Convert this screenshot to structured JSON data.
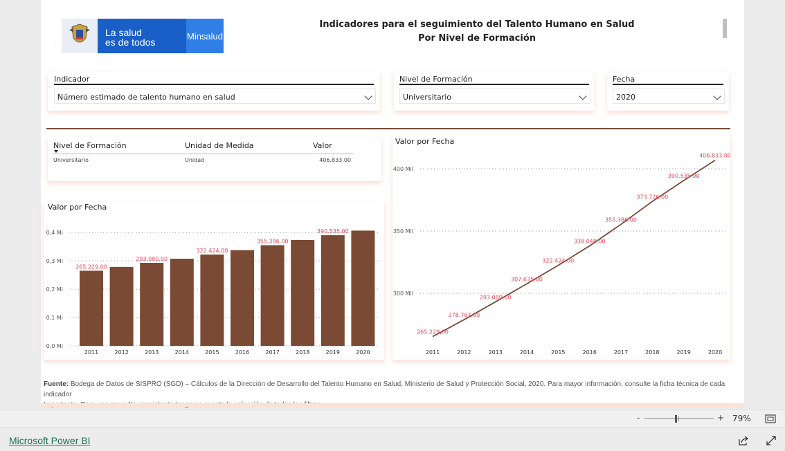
{
  "header": {
    "logo_slogan_line1": "La salud",
    "logo_slogan_line2": "es de todos",
    "logo_brand": "Minsalud",
    "title_line1": "Indicadores para el seguimiento del Talento Humano en Salud",
    "title_line2": "Por Nivel de Formación"
  },
  "filters": {
    "indicador": {
      "label": "Indicador",
      "value": "Número estimado de talento humano en salud"
    },
    "nivel": {
      "label": "Nivel de Formación",
      "value": "Universitario"
    },
    "fecha": {
      "label": "Fecha",
      "value": "2020"
    }
  },
  "table": {
    "headers": [
      "Nivel de Formación",
      "Unidad de Medida",
      "Valor"
    ],
    "row": [
      "Universitario",
      "Unidad",
      "406.833,00"
    ]
  },
  "bar_chart_title": "Valor por Fecha",
  "line_chart_title": "Valor por Fecha",
  "chart_data": [
    {
      "type": "bar",
      "title": "Valor por Fecha",
      "categories": [
        "2011",
        "2012",
        "2013",
        "2014",
        "2015",
        "2016",
        "2017",
        "2018",
        "2019",
        "2020"
      ],
      "values": [
        265229,
        278767,
        293080,
        307635,
        322424,
        338048,
        355386,
        373726,
        390535,
        406833
      ],
      "data_labels": [
        "265.229,00",
        "",
        "293.080,00",
        "",
        "322.424,00",
        "",
        "355.386,00",
        "",
        "390.535,00",
        ""
      ],
      "y_ticks": [
        0,
        100000,
        200000,
        300000,
        400000
      ],
      "y_tick_labels": [
        "0,0 Mi",
        "0,1 Mi",
        "0,2 Mi",
        "0,3 Mi",
        "0,4 Mi"
      ],
      "ylim": [
        0,
        420000
      ],
      "bar_color": "#7b4a35",
      "label_color": "#e8455a"
    },
    {
      "type": "line",
      "title": "Valor por Fecha",
      "categories": [
        "2011",
        "2012",
        "2013",
        "2014",
        "2015",
        "2016",
        "2017",
        "2018",
        "2019",
        "2020"
      ],
      "values": [
        265229,
        278767,
        293080,
        307635,
        322424,
        338048,
        355386,
        373726,
        390535,
        406833
      ],
      "data_labels": [
        "265.229,00",
        "278.767,00",
        "293.080,00",
        "307.635,00",
        "322.424,00",
        "338.048,00",
        "355.386,00",
        "373.726,00",
        "390.535,00",
        "406.833,00"
      ],
      "y_ticks": [
        300000,
        350000,
        400000
      ],
      "y_tick_labels": [
        "300 Mil",
        "350 Mil",
        "400 Mil"
      ],
      "ylim": [
        260000,
        410000
      ],
      "line_color": "#7b4a35",
      "label_color": "#e8455a"
    }
  ],
  "footer": {
    "source_label": "Fuente:",
    "source_text": " Bodega de Datos de SISPRO (SGD) – Cálculos de la Dirección de Desarrollo del Talento Humano en Salud, Ministerio de Salud y Protección Social, 2020. Para mayor información, consulte la ficha técnica de cada indicador",
    "note": "Importante: Para una consulta consistente tenga en cuenta la selección de todos los filtros."
  },
  "status": {
    "zoom_minus": "-",
    "zoom_plus": "+",
    "zoom_level": "79%",
    "zoom_fraction": 0.45
  },
  "bottom": {
    "powerbi_link": "Microsoft Power BI"
  }
}
